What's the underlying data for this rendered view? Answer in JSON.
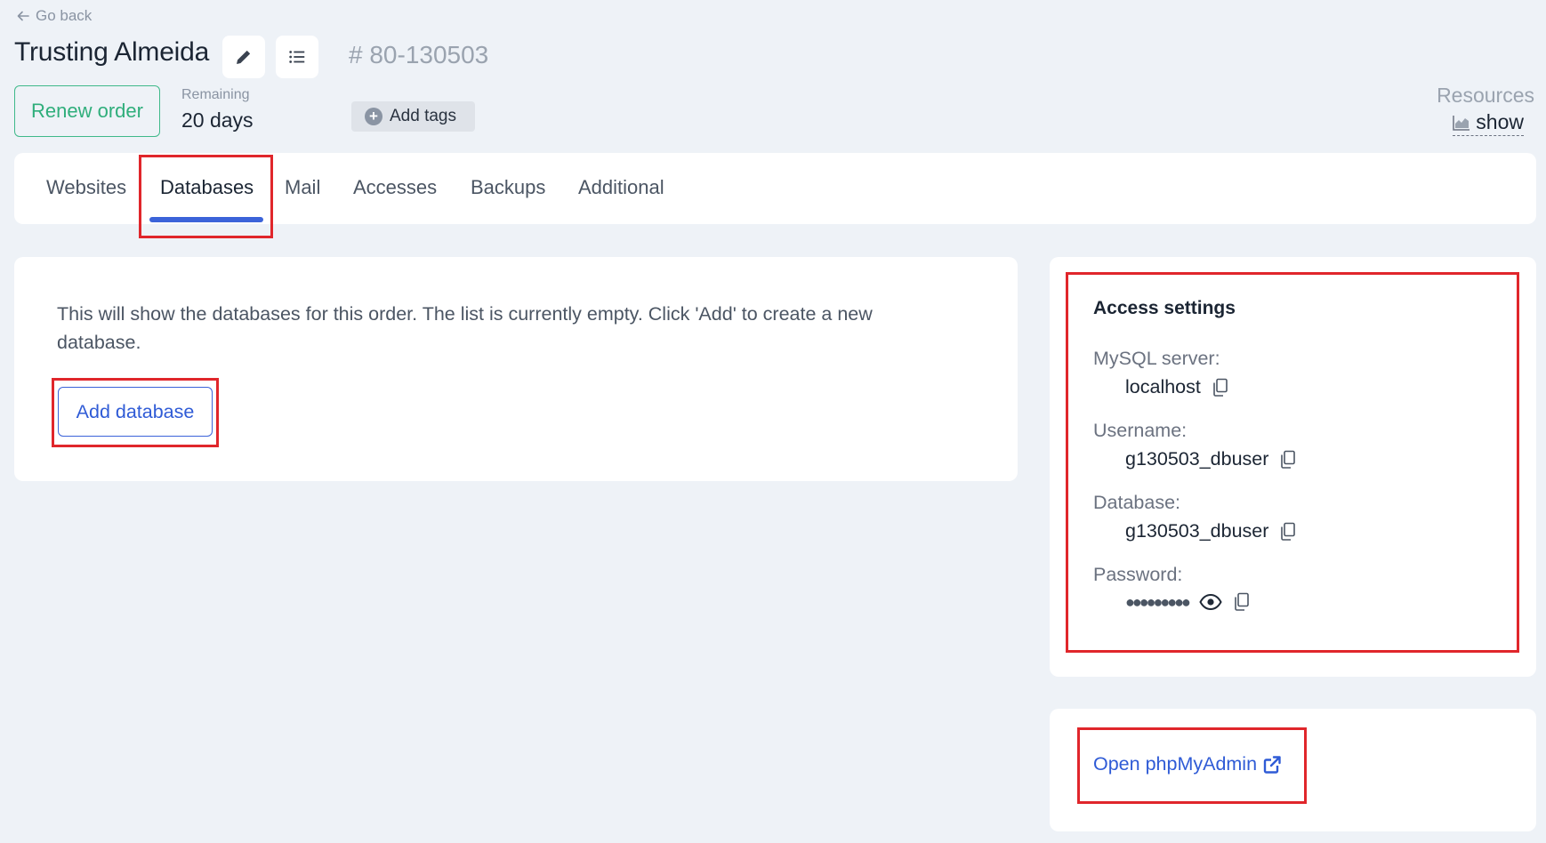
{
  "header": {
    "go_back": "Go back",
    "title": "Trusting Almeida",
    "order_id": "# 80-130503",
    "renew_label": "Renew order",
    "remaining_label": "Remaining",
    "remaining_value": "20 days",
    "add_tags_label": "Add tags",
    "resources_label": "Resources",
    "resources_show": "show"
  },
  "tabs": [
    {
      "label": "Websites",
      "active": false
    },
    {
      "label": "Databases",
      "active": true
    },
    {
      "label": "Mail",
      "active": false
    },
    {
      "label": "Accesses",
      "active": false
    },
    {
      "label": "Backups",
      "active": false
    },
    {
      "label": "Additional",
      "active": false
    }
  ],
  "main": {
    "empty_text": "This will show the databases for this order. The list is currently empty. Click 'Add' to create a new database.",
    "add_database_label": "Add database"
  },
  "access": {
    "title": "Access settings",
    "fields": [
      {
        "label": "MySQL server:",
        "value": "localhost"
      },
      {
        "label": "Username:",
        "value": "g130503_dbuser"
      },
      {
        "label": "Database:",
        "value": "g130503_dbuser"
      },
      {
        "label": "Password:",
        "value": "●●●●●●●●●"
      }
    ]
  },
  "phpmyadmin": {
    "label": "Open phpMyAdmin"
  },
  "colors": {
    "accent": "#3b63d9",
    "renew": "#2fae7b",
    "highlight": "#e0262b",
    "background": "#eef2f7"
  }
}
